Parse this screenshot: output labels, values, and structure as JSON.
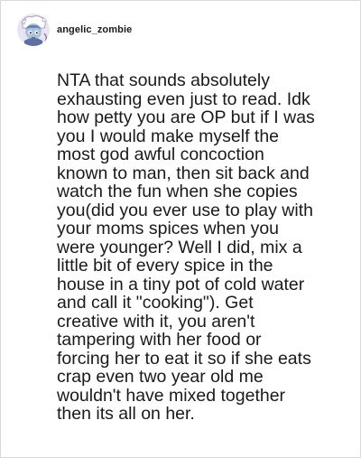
{
  "post": {
    "username": "angelic_zombie",
    "avatar_icon": "anime-girl-avatar-icon",
    "comment_lines": "NTA that sounds absolutely\nexhausting even just to read. Idk\nhow petty you are OP but if I was\nyou I would make myself the\nmost god awful concoction\nknown to man, then sit back and\nwatch the fun when she copies\nyou(did you ever use to play with\nyour moms spices when you\nwere younger? Well I did, mix a\nlittle bit of every spice in the\nhouse in a tiny pot of cold water\nand call it \"cooking\"). Get\ncreative with it, you aren't\ntampering with her food or\nforcing her to eat it so if she eats\ncrap even two year old me\nwouldn't have mixed together\nthen its all on her."
  },
  "colors": {
    "text": "#1a1a1a",
    "border": "#d9d9d9",
    "background": "#ffffff"
  }
}
